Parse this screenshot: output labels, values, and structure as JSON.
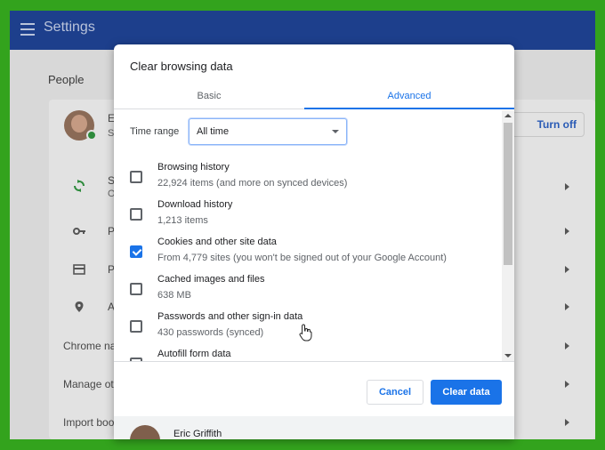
{
  "app": {
    "title": "Settings"
  },
  "people": {
    "section_title": "People",
    "turn_off_label": "Turn off",
    "rows": [
      {
        "icon": "sync-icon",
        "text_a": "S",
        "text_b": "O"
      },
      {
        "icon": "key-icon",
        "text_a": "P"
      },
      {
        "icon": "credit-card-icon",
        "text_a": "P"
      },
      {
        "icon": "location-pin-icon",
        "text_a": "A"
      },
      {
        "text": "Chrome na"
      },
      {
        "text": "Manage ot"
      },
      {
        "text": "Import boo"
      }
    ],
    "user_initial_a": "E",
    "user_initial_b": "S"
  },
  "dialog": {
    "title": "Clear browsing data",
    "tabs": [
      {
        "label": "Basic",
        "active": false
      },
      {
        "label": "Advanced",
        "active": true
      }
    ],
    "time_range": {
      "label": "Time range",
      "value": "All time"
    },
    "items": [
      {
        "label": "Browsing history",
        "desc": "22,924 items (and more on synced devices)",
        "checked": false
      },
      {
        "label": "Download history",
        "desc": "1,213 items",
        "checked": false
      },
      {
        "label": "Cookies and other site data",
        "desc": "From 4,779 sites (you won't be signed out of your Google Account)",
        "checked": true
      },
      {
        "label": "Cached images and files",
        "desc": "638 MB",
        "checked": false
      },
      {
        "label": "Passwords and other sign-in data",
        "desc": "430 passwords (synced)",
        "checked": false
      },
      {
        "label": "Autofill form data",
        "desc": "",
        "checked": false
      }
    ],
    "buttons": {
      "cancel": "Cancel",
      "clear": "Clear data"
    },
    "account_name": "Eric Griffith"
  },
  "colors": {
    "accent": "#1a73e8",
    "frame": "#33a31d",
    "header": "#1d3f8c"
  }
}
